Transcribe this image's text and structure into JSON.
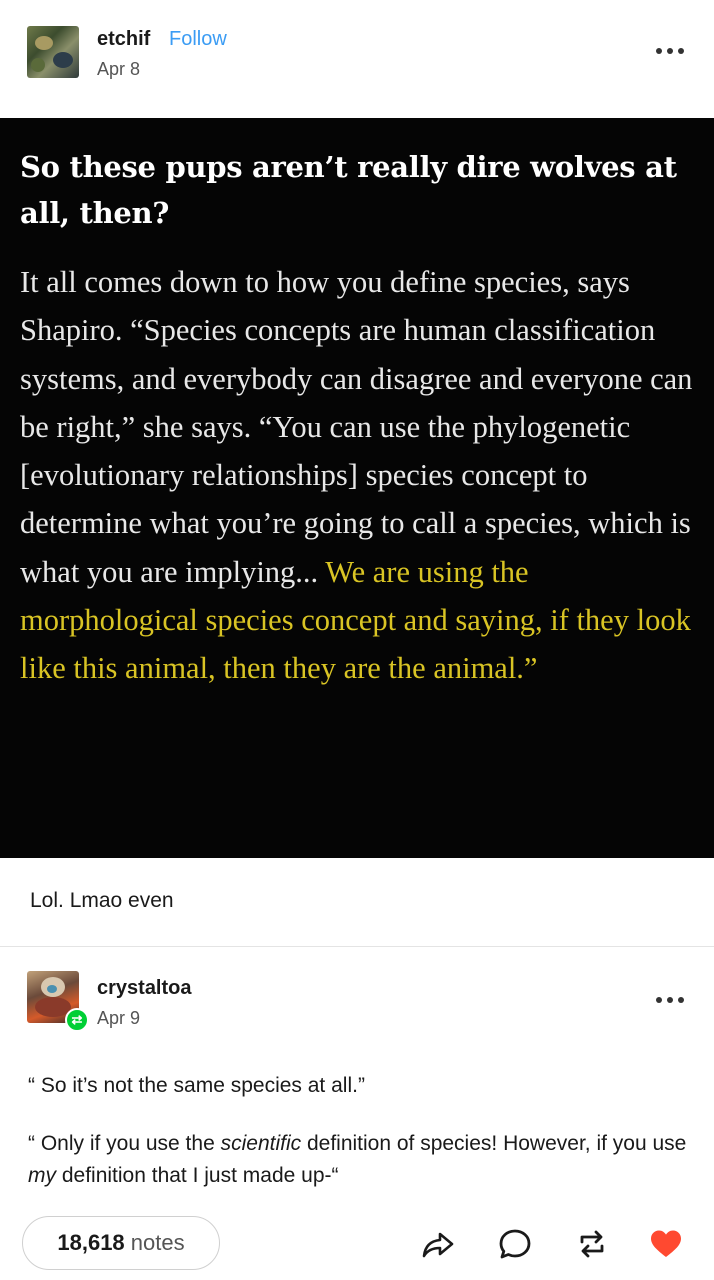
{
  "post": {
    "username": "etchif",
    "follow_label": "Follow",
    "date": "Apr 8",
    "quote_heading": "So these pups aren’t really dire wolves at all, then?",
    "quote_body_plain": "It all comes down to how you define species, says Shapiro. “Species concepts are human classification systems, and everybody can disagree and everyone can be right,” she says. “You can use the phylogenetic [evolutionary relationships] species concept to determine what you’re going to call a species, which is what you are implying...",
    "quote_body_highlight": "We are using the morphological species concept and saying, if they look like this animal, then they are the animal.”",
    "caption": "Lol. Lmao even"
  },
  "reblog": {
    "username": "crystaltoa",
    "date": "Apr 9",
    "line1": "“ So it’s not the same species at all.”",
    "line2_a": "“ Only if you use the ",
    "line2_em1": "scientific",
    "line2_b": " definition of species! However, if you use ",
    "line2_em2": "my",
    "line2_c": " definition that I just made up-“"
  },
  "footer": {
    "notes_count": "18,618",
    "notes_label": "notes"
  },
  "colors": {
    "follow": "#3b9cf4",
    "highlight": "#d9c424",
    "like": "#ff4930",
    "reblog_badge": "#00cf35"
  },
  "icons": [
    "more-icon",
    "reblog-badge-icon",
    "share-icon",
    "reply-icon",
    "reblog-icon",
    "heart-icon"
  ]
}
